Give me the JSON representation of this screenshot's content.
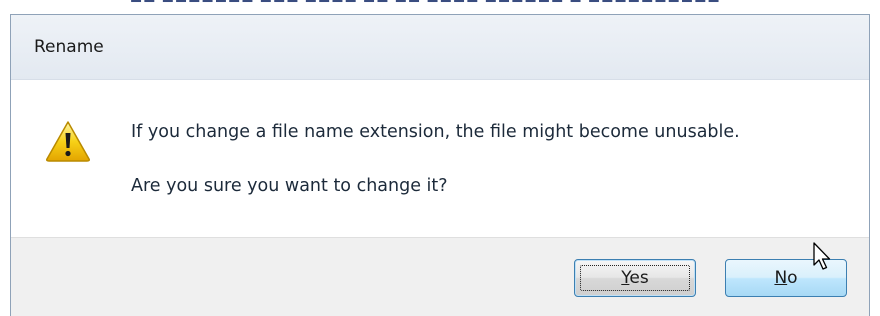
{
  "dialog": {
    "title": "Rename",
    "message_line1": "If you change a file name extension, the file might become unusable.",
    "message_line2": "Are you sure you want to change it?",
    "icon": "warning-icon",
    "buttons": {
      "yes": {
        "label_accel": "Y",
        "label_rest": "es"
      },
      "no": {
        "label_accel": "N",
        "label_rest": "o"
      }
    }
  },
  "colors": {
    "title_bar": "#e3e9f1",
    "content_bg": "#ffffff",
    "footer_bg": "#f0f0f0",
    "accent_border": "#3c7fb1",
    "warning_yellow": "#f7d117"
  }
}
